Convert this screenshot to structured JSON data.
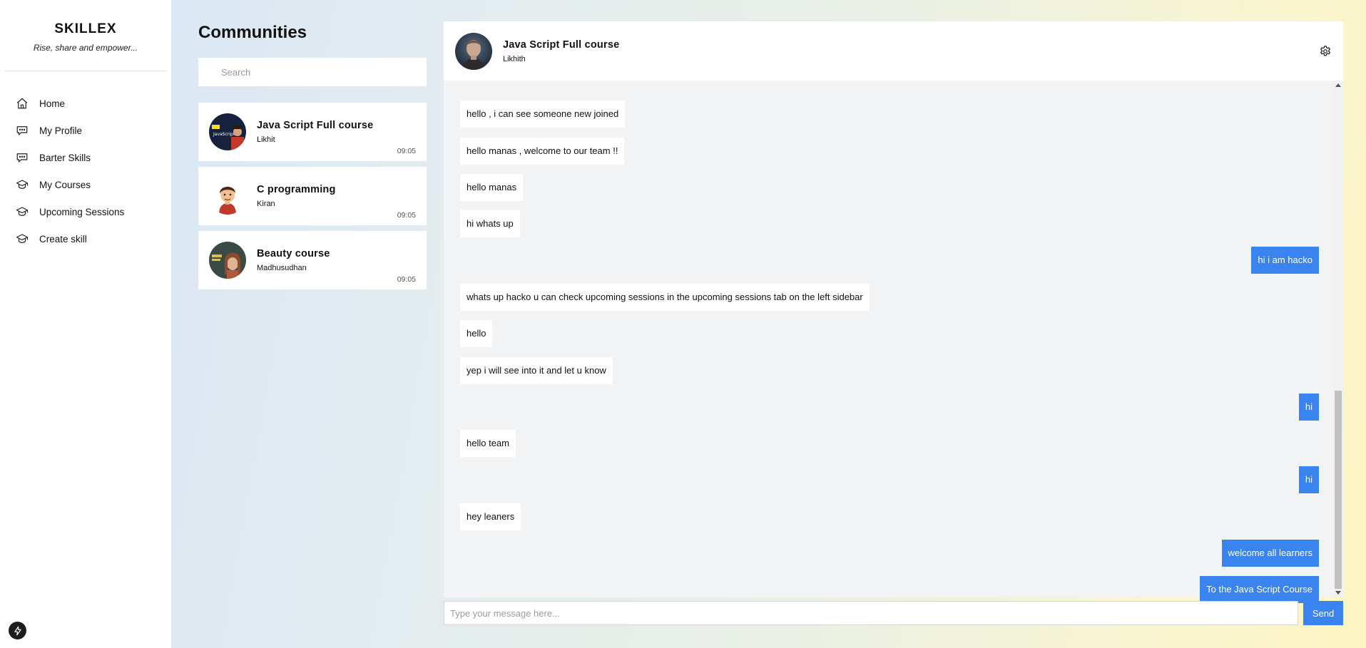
{
  "brand": {
    "title": "SKILLEX",
    "tagline": "Rise, share and empower..."
  },
  "nav": [
    {
      "label": "Home",
      "icon": "home-icon"
    },
    {
      "label": "My Profile",
      "icon": "chat-bubble-icon"
    },
    {
      "label": "Barter Skills",
      "icon": "chat-bubble-icon"
    },
    {
      "label": "My Courses",
      "icon": "graduation-cap-icon"
    },
    {
      "label": "Upcoming Sessions",
      "icon": "graduation-cap-icon"
    },
    {
      "label": "Create skill",
      "icon": "graduation-cap-icon"
    }
  ],
  "communities": {
    "title": "Communities",
    "search_placeholder": "Search",
    "items": [
      {
        "name": "Java Script Full course",
        "owner": "Likhit",
        "time": "09:05"
      },
      {
        "name": "C programming",
        "owner": "Kiran",
        "time": "09:05"
      },
      {
        "name": "Beauty course",
        "owner": "Madhusudhan",
        "time": "09:05"
      }
    ]
  },
  "chat": {
    "title": "Java Script Full course",
    "subtitle": "Likhith",
    "messages": [
      {
        "text": "hello , i can see someone new joined",
        "dir": "in"
      },
      {
        "text": "hello manas , welcome to our team !!",
        "dir": "in"
      },
      {
        "text": "hello manas",
        "dir": "in"
      },
      {
        "text": "hi whats up",
        "dir": "in"
      },
      {
        "text": "hi i am hacko",
        "dir": "out"
      },
      {
        "text": "whats up hacko u can check upcoming sessions in the upcoming sessions tab on the left sidebar",
        "dir": "in"
      },
      {
        "text": "hello",
        "dir": "in"
      },
      {
        "text": "yep i will see into it and let u know",
        "dir": "in"
      },
      {
        "text": "hi",
        "dir": "out"
      },
      {
        "text": "hello team",
        "dir": "in"
      },
      {
        "text": "hi",
        "dir": "out"
      },
      {
        "text": "hey leaners",
        "dir": "in"
      },
      {
        "text": "welcome all learners",
        "dir": "out"
      },
      {
        "text": "To the Java Script Course",
        "dir": "out"
      }
    ],
    "input_placeholder": "Type your message here...",
    "send_label": "Send"
  },
  "colors": {
    "accent": "#3a84f0",
    "sidebar_bg": "#ffffff",
    "chat_bg": "#f1f3f5",
    "gradient_start": "#dbe7f4",
    "gradient_end": "#fdf5c2"
  }
}
